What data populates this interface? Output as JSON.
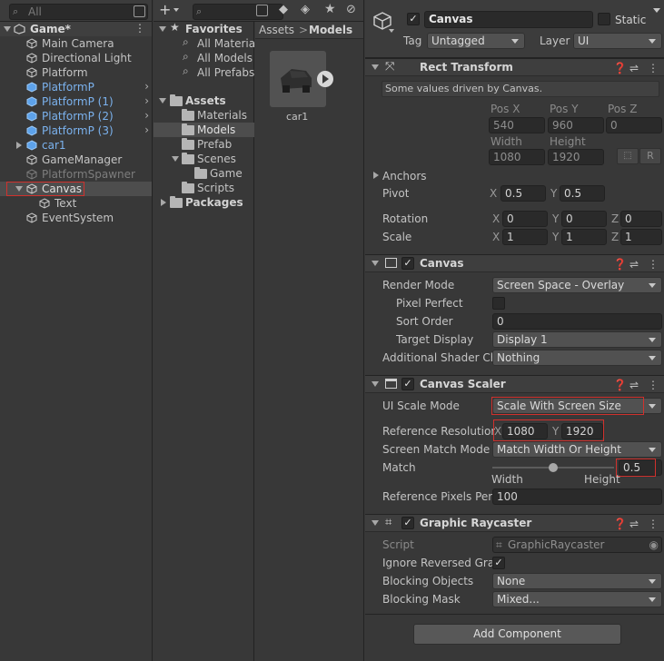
{
  "hierarchy": {
    "search_placeholder": "All",
    "scene_name": "Game*",
    "items": [
      {
        "label": "Main Camera"
      },
      {
        "label": "Directional Light"
      },
      {
        "label": "Platform"
      },
      {
        "label": "PlatformP"
      },
      {
        "label": "PlatformP (1)"
      },
      {
        "label": "PlatformP (2)"
      },
      {
        "label": "PlatformP (3)"
      },
      {
        "label": "car1"
      },
      {
        "label": "GameManager"
      },
      {
        "label": "PlatformSpawner"
      },
      {
        "label": "Canvas"
      },
      {
        "label": "Text"
      },
      {
        "label": "EventSystem"
      }
    ]
  },
  "project": {
    "add_label": "+",
    "tree": {
      "favorites": "Favorites",
      "fav_items": [
        "All Materia",
        "All Models",
        "All Prefabs"
      ],
      "assets": "Assets",
      "asset_items": [
        "Materials",
        "Models",
        "Prefab",
        "Scenes",
        "Game",
        "Scripts"
      ],
      "packages": "Packages"
    },
    "breadcrumb": {
      "root": "Assets",
      "sep": ">",
      "current": "Models"
    },
    "asset": {
      "name": "car1"
    }
  },
  "inspector": {
    "object_name": "Canvas",
    "static_label": "Static",
    "tag_label": "Tag",
    "tag_value": "Untagged",
    "layer_label": "Layer",
    "layer_value": "UI",
    "rect_transform": {
      "title": "Rect Transform",
      "note": "Some values driven by Canvas.",
      "pos_x_label": "Pos X",
      "pos_y_label": "Pos Y",
      "pos_z_label": "Pos Z",
      "pos_x": "540",
      "pos_y": "960",
      "pos_z": "0",
      "width_label": "Width",
      "height_label": "Height",
      "width": "1080",
      "height": "1920",
      "r_button": "R",
      "anchors_label": "Anchors",
      "pivot_label": "Pivot",
      "pivot_x": "0.5",
      "pivot_y": "0.5",
      "rotation_label": "Rotation",
      "rot_x": "0",
      "rot_y": "0",
      "rot_z": "0",
      "scale_label": "Scale",
      "scale_x": "1",
      "scale_y": "1",
      "scale_z": "1",
      "x": "X",
      "y": "Y",
      "z": "Z"
    },
    "canvas": {
      "title": "Canvas",
      "render_mode_label": "Render Mode",
      "render_mode": "Screen Space - Overlay",
      "pixel_perfect_label": "Pixel Perfect",
      "sort_order_label": "Sort Order",
      "sort_order": "0",
      "target_display_label": "Target Display",
      "target_display": "Display 1",
      "shader_channels_label": "Additional Shader Ch",
      "shader_channels": "Nothing"
    },
    "canvas_scaler": {
      "title": "Canvas Scaler",
      "ui_scale_mode_label": "UI Scale Mode",
      "ui_scale_mode": "Scale With Screen Size",
      "ref_res_label": "Reference Resolution",
      "ref_x": "1080",
      "ref_y": "1920",
      "match_mode_label": "Screen Match Mode",
      "match_mode": "Match Width Or Height",
      "match_label": "Match",
      "match_value": "0.5",
      "match_fraction": 0.5,
      "width_caption": "Width",
      "height_caption": "Height",
      "ref_ppu_label": "Reference Pixels Per",
      "ref_ppu": "100"
    },
    "graphic_raycaster": {
      "title": "Graphic Raycaster",
      "script_label": "Script",
      "script_value": "GraphicRaycaster",
      "ignore_reversed_label": "Ignore Reversed Grap",
      "blocking_objects_label": "Blocking Objects",
      "blocking_objects": "None",
      "blocking_mask_label": "Blocking Mask",
      "blocking_mask": "Mixed..."
    },
    "add_component": "Add Component"
  },
  "colors": {
    "accent_blue": "#7bb2ee",
    "highlight_red": "#d0312d",
    "panel_bg": "#383838"
  }
}
